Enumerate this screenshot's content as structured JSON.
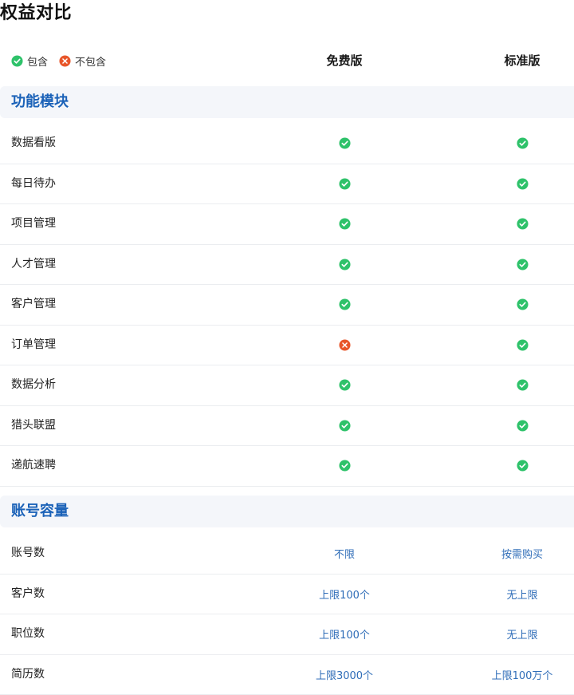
{
  "page_title": "权益对比",
  "legend": {
    "include": "包含",
    "exclude": "不包含"
  },
  "columns": {
    "free": "免费版",
    "standard": "标准版"
  },
  "colors": {
    "check": "#2ec26a",
    "cross": "#e8562a",
    "section_title": "#1b62b8",
    "value_text": "#2f6db8"
  },
  "sections": [
    {
      "title": "功能模块",
      "rows": [
        {
          "label": "数据看版",
          "free": "check",
          "standard": "check"
        },
        {
          "label": "每日待办",
          "free": "check",
          "standard": "check"
        },
        {
          "label": "项目管理",
          "free": "check",
          "standard": "check"
        },
        {
          "label": "人才管理",
          "free": "check",
          "standard": "check"
        },
        {
          "label": "客户管理",
          "free": "check",
          "standard": "check"
        },
        {
          "label": "订单管理",
          "free": "cross",
          "standard": "check"
        },
        {
          "label": "数据分析",
          "free": "check",
          "standard": "check"
        },
        {
          "label": "猎头联盟",
          "free": "check",
          "standard": "check"
        },
        {
          "label": "递航速聘",
          "free": "check",
          "standard": "check"
        }
      ]
    },
    {
      "title": "账号容量",
      "rows": [
        {
          "label": "账号数",
          "free": "不限",
          "standard": "按需购买"
        },
        {
          "label": "客户数",
          "free": "上限100个",
          "standard": "无上限"
        },
        {
          "label": "职位数",
          "free": "上限100个",
          "standard": "无上限"
        },
        {
          "label": "简历数",
          "free": "上限3000个",
          "standard": "上限100万个"
        }
      ]
    }
  ]
}
